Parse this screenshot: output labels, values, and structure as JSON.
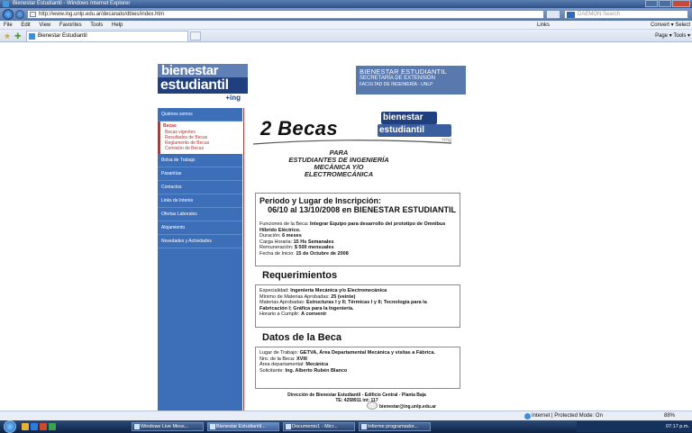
{
  "window": {
    "title": "Bienestar Estudiantil - Windows Internet Explorer"
  },
  "address": {
    "url": "http://www.ing.unlp.edu.ar/decanato/dbies/index.htm",
    "search_placeholder": "DAEMON Search"
  },
  "menu": {
    "items": [
      "File",
      "Edit",
      "View",
      "Favorites",
      "Tools",
      "Help"
    ],
    "links_label": "Links",
    "right_tools": "Convert  ▾  Select"
  },
  "tab": {
    "label": "Bienestar Estudiantil"
  },
  "command_bar": {
    "text": "Page ▾  Tools ▾"
  },
  "banner": {
    "logo_line1": "bienestar",
    "logo_line2": "estudiantil",
    "logo_line3": "+ing",
    "right_line1": "BIENESTAR ESTUDIANTIL",
    "right_line2": "SECRETARÍA DE EXTENSIÓN",
    "right_line3": "FACULTAD DE INGENIERÍA - UNLP"
  },
  "sidebar": {
    "top_item": "Quiénes somos",
    "becas_head": "Becas",
    "becas_sub": [
      "Becas vigentes",
      "Resultados de Becas",
      "Reglamento de Becas",
      "Comisión de Becas"
    ],
    "items": [
      "Bolsa de Trabajo",
      "Pasantías",
      "Contactos",
      "Links de Interés",
      "Ofertas Laborales",
      "Alojamiento",
      "Novedades y Actividades"
    ]
  },
  "content": {
    "title": "2 Becas",
    "logo_line1": "bienestar",
    "logo_line2": "estudiantil",
    "logo_line3": "+ing",
    "para_lines": [
      "PARA",
      "ESTUDIANTES DE INGENIERÍA",
      "MECÁNICA Y/O",
      "ELECTROMECÁNICA"
    ],
    "box1": {
      "heading1": "Periodo y Lugar de Inscripción:",
      "heading2": "06/10 al 13/10/2008 en BIENESTAR ESTUDIANTIL",
      "funciones_label": "Funciones de la Beca:",
      "funciones_value": "Integrar Equipo para desarrollo del prototipo de Omnibus Híbrido Eléctrico.",
      "duracion_label": "Duración:",
      "duracion_value": "6 meses",
      "carga_label": "Carga Horaria:",
      "carga_value": "15 Hs Semanales",
      "remun_label": "Remuneración:",
      "remun_value": "$ 500 mensuales",
      "inicio_label": "Fecha de Inicio:",
      "inicio_value": "15 de Octubre de 2008"
    },
    "req_title": "Requerimientos",
    "box2": {
      "esp_label": "Especialidad:",
      "esp_value": "Ingeniería Mecánica y/o Electromecánica",
      "min_label": "Mínimo de Materias Aprobadas:",
      "min_value": "25 (veinte)",
      "mat_label": "Materias Aprobadas:",
      "mat_value": "Estructuras I y II; Térmicas I y II; Tecnología para la Fabricación I; Gráfica para la Ingeniería.",
      "hor_label": "Horario a Cumplir:",
      "hor_value": "A convenir"
    },
    "datos_title": "Datos de la Beca",
    "box3": {
      "lugar_label": "Lugar de Trabajo:",
      "lugar_value": "GETVA, Área Departamental Mecánica y visitas a Fábrica.",
      "nro_label": "Nro. de la Beca:",
      "nro_value": "XVIII",
      "area_label": "Área departamental:",
      "area_value": "Mecánica",
      "sol_label": "Solicitante:",
      "sol_value": "Ing. Alberto Rubén Blanco"
    },
    "footer_line1": "Dirección de Bienestar Estudiantil - Edificio Central - Planta Baja",
    "footer_line2": "TE: 4258911 int: 117",
    "footer_email": "bienestar@ing.unlp.edu.ar"
  },
  "status": {
    "zone": "Internet | Protected Mode: On",
    "zoom": "88%"
  },
  "taskbar": {
    "tasks": [
      "Windows Live Mess...",
      "Bienestar Estudiantil...",
      "Documento1 - Micr...",
      "Informe programador..."
    ],
    "clock": "07:17 p.m."
  },
  "colors": {
    "brand_blue": "#3d6fb8",
    "accent_red": "#c4302b",
    "dark_blue": "#1f3f7e"
  }
}
